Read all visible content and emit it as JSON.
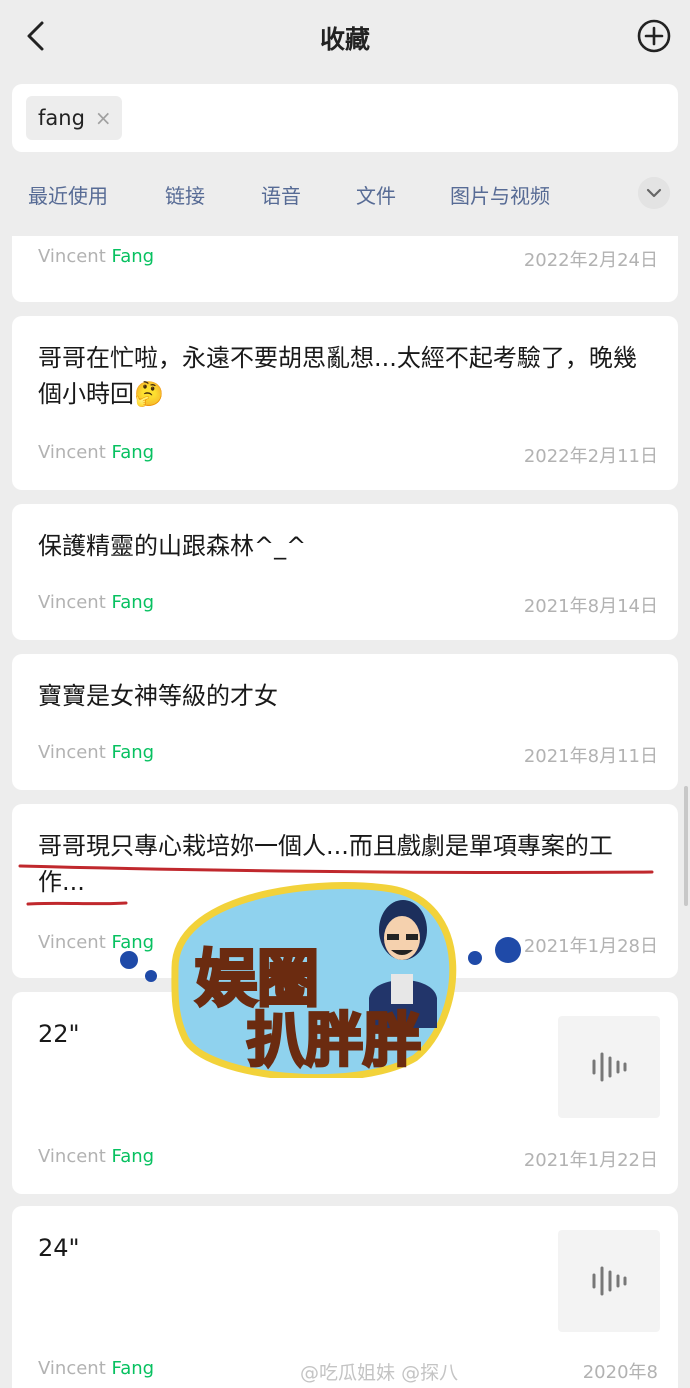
{
  "header": {
    "title": "收藏",
    "back_icon": "chevron-left-icon",
    "add_icon": "plus-circle-icon"
  },
  "search": {
    "chip_text": "fang",
    "chip_close": "×"
  },
  "filters": {
    "tabs": [
      "最近使用",
      "链接",
      "语音",
      "文件",
      "图片与视频"
    ],
    "more_icon": "chevron-down-icon"
  },
  "items": [
    {
      "text": "",
      "author_first": "Vincent ",
      "author_last": "Fang",
      "date": "2022年2月24日"
    },
    {
      "text": "哥哥在忙啦，永遠不要胡思亂想...太經不起考驗了，晚幾個小時回🤔",
      "author_first": "Vincent ",
      "author_last": "Fang",
      "date": "2022年2月11日"
    },
    {
      "text": "保護精靈的山跟森林^_^",
      "author_first": "Vincent ",
      "author_last": "Fang",
      "date": "2021年8月14日"
    },
    {
      "text": "寶寶是女神等級的才女",
      "author_first": "Vincent ",
      "author_last": "Fang",
      "date": "2021年8月11日"
    },
    {
      "text": "哥哥現只專心栽培妳一個人...而且戲劇是單項專案的工作...",
      "author_first": "Vincent ",
      "author_last": "Fang",
      "date": "2021年1月28日"
    },
    {
      "duration": "22\"",
      "author_first": "Vincent ",
      "author_last": "Fang",
      "date": "2021年1月22日",
      "thumb_icon": "voice-waveform-icon"
    },
    {
      "duration": "24\"",
      "author_first": "Vincent ",
      "author_last": "Fang",
      "date": "2020年8",
      "thumb_icon": "voice-waveform-icon"
    }
  ],
  "overlay": {
    "watermark": "@吃瓜姐妹",
    "watermark_2": "@探八",
    "sticker_line1": "娱圈",
    "sticker_line2": "扒胖胖"
  },
  "colors": {
    "link_blue": "#576b95",
    "green": "#07c160",
    "grey_text": "#b2b2b2",
    "underline_red": "#c0282d"
  }
}
